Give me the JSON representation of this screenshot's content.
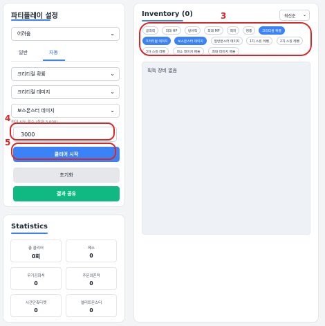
{
  "left_panel": {
    "title": "파티플레이 설정",
    "party_select": "어려움",
    "tabs": [
      "일반",
      "자동"
    ],
    "stat_select_1": "크리티컬 확률",
    "stat_select_2": "크리티컬 데미지",
    "stat_select_3": "보스몬스터 데미지",
    "attempt_hint": "최대 시도 횟수 (최대 3,000)",
    "attempt_value": "3000",
    "start_button": "클리어 시작",
    "reset_button": "초기화",
    "share_button": "결과 공유"
  },
  "statistics": {
    "title": "Statistics",
    "cells": [
      {
        "label": "총 클리어",
        "value": "0회"
      },
      {
        "label": "메소",
        "value": "0"
      },
      {
        "label": "무기강화석",
        "value": "0"
      },
      {
        "label": "주문의흔적",
        "value": "0"
      },
      {
        "label": "시간단축티켓",
        "value": "0"
      },
      {
        "label": "엘리트몬스터",
        "value": "0"
      }
    ]
  },
  "inventory": {
    "title": "Inventory (0)",
    "sort_select": "최신순",
    "chips": [
      "공격력",
      "최대 HP",
      "방어력",
      "최대 MP",
      "회피",
      "명중",
      "크리티컬 확률",
      "크리티컬 데미지",
      "보스몬스터 데미지",
      "일반몬스터 데미지",
      "1차 스킬 레벨",
      "2차 스킬 레벨",
      "3차 스킬 레벨",
      "최소 데미지 배율",
      "최대 데미지 배율"
    ],
    "empty_text": "획득 장비 없음"
  },
  "annotations": {
    "num3": "3",
    "num4": "4",
    "num5": "5"
  },
  "colors": {
    "accent": "#3b82f6",
    "share": "#10b981",
    "annotation": "#dc2626"
  }
}
